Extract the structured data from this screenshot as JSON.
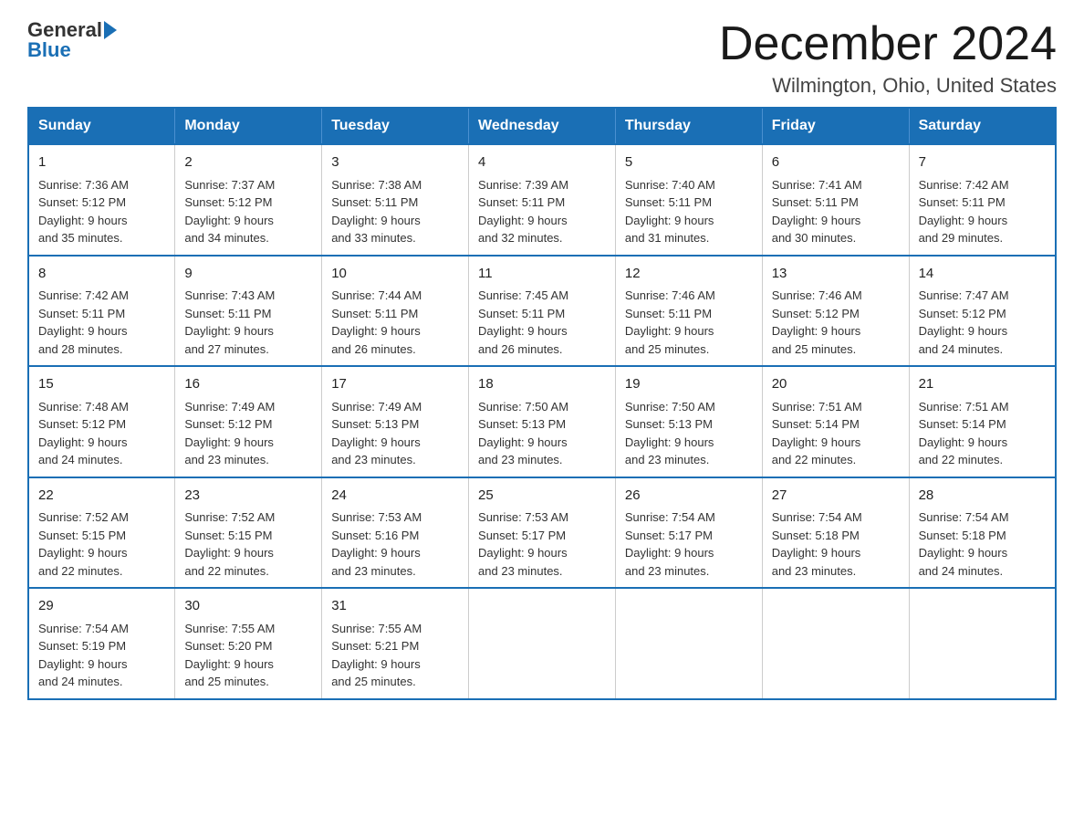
{
  "logo": {
    "general": "General",
    "blue": "Blue",
    "line2": "Blue"
  },
  "title": "December 2024",
  "subtitle": "Wilmington, Ohio, United States",
  "days_header": [
    "Sunday",
    "Monday",
    "Tuesday",
    "Wednesday",
    "Thursday",
    "Friday",
    "Saturday"
  ],
  "weeks": [
    [
      {
        "day": "1",
        "sunrise": "7:36 AM",
        "sunset": "5:12 PM",
        "daylight": "9 hours and 35 minutes."
      },
      {
        "day": "2",
        "sunrise": "7:37 AM",
        "sunset": "5:12 PM",
        "daylight": "9 hours and 34 minutes."
      },
      {
        "day": "3",
        "sunrise": "7:38 AM",
        "sunset": "5:11 PM",
        "daylight": "9 hours and 33 minutes."
      },
      {
        "day": "4",
        "sunrise": "7:39 AM",
        "sunset": "5:11 PM",
        "daylight": "9 hours and 32 minutes."
      },
      {
        "day": "5",
        "sunrise": "7:40 AM",
        "sunset": "5:11 PM",
        "daylight": "9 hours and 31 minutes."
      },
      {
        "day": "6",
        "sunrise": "7:41 AM",
        "sunset": "5:11 PM",
        "daylight": "9 hours and 30 minutes."
      },
      {
        "day": "7",
        "sunrise": "7:42 AM",
        "sunset": "5:11 PM",
        "daylight": "9 hours and 29 minutes."
      }
    ],
    [
      {
        "day": "8",
        "sunrise": "7:42 AM",
        "sunset": "5:11 PM",
        "daylight": "9 hours and 28 minutes."
      },
      {
        "day": "9",
        "sunrise": "7:43 AM",
        "sunset": "5:11 PM",
        "daylight": "9 hours and 27 minutes."
      },
      {
        "day": "10",
        "sunrise": "7:44 AM",
        "sunset": "5:11 PM",
        "daylight": "9 hours and 26 minutes."
      },
      {
        "day": "11",
        "sunrise": "7:45 AM",
        "sunset": "5:11 PM",
        "daylight": "9 hours and 26 minutes."
      },
      {
        "day": "12",
        "sunrise": "7:46 AM",
        "sunset": "5:11 PM",
        "daylight": "9 hours and 25 minutes."
      },
      {
        "day": "13",
        "sunrise": "7:46 AM",
        "sunset": "5:12 PM",
        "daylight": "9 hours and 25 minutes."
      },
      {
        "day": "14",
        "sunrise": "7:47 AM",
        "sunset": "5:12 PM",
        "daylight": "9 hours and 24 minutes."
      }
    ],
    [
      {
        "day": "15",
        "sunrise": "7:48 AM",
        "sunset": "5:12 PM",
        "daylight": "9 hours and 24 minutes."
      },
      {
        "day": "16",
        "sunrise": "7:49 AM",
        "sunset": "5:12 PM",
        "daylight": "9 hours and 23 minutes."
      },
      {
        "day": "17",
        "sunrise": "7:49 AM",
        "sunset": "5:13 PM",
        "daylight": "9 hours and 23 minutes."
      },
      {
        "day": "18",
        "sunrise": "7:50 AM",
        "sunset": "5:13 PM",
        "daylight": "9 hours and 23 minutes."
      },
      {
        "day": "19",
        "sunrise": "7:50 AM",
        "sunset": "5:13 PM",
        "daylight": "9 hours and 23 minutes."
      },
      {
        "day": "20",
        "sunrise": "7:51 AM",
        "sunset": "5:14 PM",
        "daylight": "9 hours and 22 minutes."
      },
      {
        "day": "21",
        "sunrise": "7:51 AM",
        "sunset": "5:14 PM",
        "daylight": "9 hours and 22 minutes."
      }
    ],
    [
      {
        "day": "22",
        "sunrise": "7:52 AM",
        "sunset": "5:15 PM",
        "daylight": "9 hours and 22 minutes."
      },
      {
        "day": "23",
        "sunrise": "7:52 AM",
        "sunset": "5:15 PM",
        "daylight": "9 hours and 22 minutes."
      },
      {
        "day": "24",
        "sunrise": "7:53 AM",
        "sunset": "5:16 PM",
        "daylight": "9 hours and 23 minutes."
      },
      {
        "day": "25",
        "sunrise": "7:53 AM",
        "sunset": "5:17 PM",
        "daylight": "9 hours and 23 minutes."
      },
      {
        "day": "26",
        "sunrise": "7:54 AM",
        "sunset": "5:17 PM",
        "daylight": "9 hours and 23 minutes."
      },
      {
        "day": "27",
        "sunrise": "7:54 AM",
        "sunset": "5:18 PM",
        "daylight": "9 hours and 23 minutes."
      },
      {
        "day": "28",
        "sunrise": "7:54 AM",
        "sunset": "5:18 PM",
        "daylight": "9 hours and 24 minutes."
      }
    ],
    [
      {
        "day": "29",
        "sunrise": "7:54 AM",
        "sunset": "5:19 PM",
        "daylight": "9 hours and 24 minutes."
      },
      {
        "day": "30",
        "sunrise": "7:55 AM",
        "sunset": "5:20 PM",
        "daylight": "9 hours and 25 minutes."
      },
      {
        "day": "31",
        "sunrise": "7:55 AM",
        "sunset": "5:21 PM",
        "daylight": "9 hours and 25 minutes."
      },
      null,
      null,
      null,
      null
    ]
  ],
  "labels": {
    "sunrise": "Sunrise:",
    "sunset": "Sunset:",
    "daylight": "Daylight:"
  }
}
